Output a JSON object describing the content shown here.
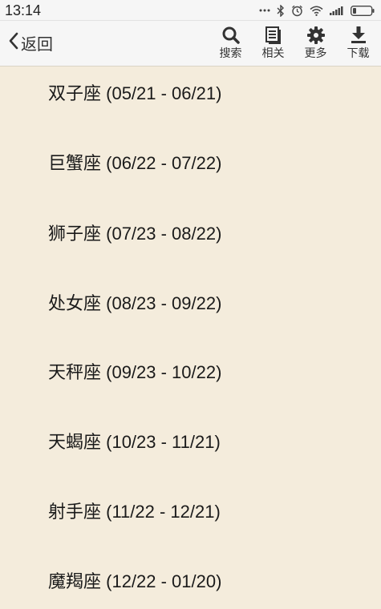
{
  "status_bar": {
    "time": "13:14"
  },
  "toolbar": {
    "back_label": "返回",
    "actions": [
      {
        "label": "搜索",
        "icon": "search-icon"
      },
      {
        "label": "相关",
        "icon": "document-icon"
      },
      {
        "label": "更多",
        "icon": "gear-icon"
      },
      {
        "label": "下载",
        "icon": "download-icon"
      }
    ]
  },
  "list": [
    {
      "name": "双子座",
      "range": " (05/21 - 06/21)"
    },
    {
      "name": "巨蟹座",
      "range": " (06/22 - 07/22)"
    },
    {
      "name": "狮子座",
      "range": " (07/23 - 08/22)"
    },
    {
      "name": "处女座",
      "range": " (08/23 - 09/22)"
    },
    {
      "name": "天秤座",
      "range": " (09/23 - 10/22)"
    },
    {
      "name": "天蝎座",
      "range": " (10/23 - 11/21)"
    },
    {
      "name": "射手座",
      "range": " (11/22 - 12/21)"
    },
    {
      "name": "魔羯座",
      "range": " (12/22 - 01/20)"
    }
  ]
}
